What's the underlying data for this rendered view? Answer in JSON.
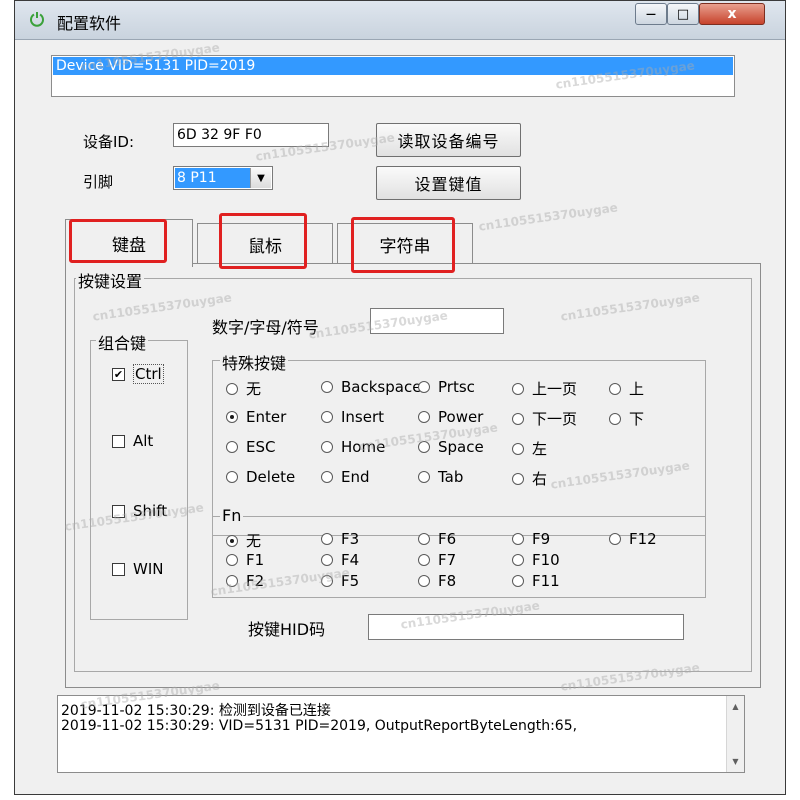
{
  "window": {
    "title": "配置软件",
    "minimize": "—",
    "maximize": "□",
    "close": "x"
  },
  "device_list": {
    "selected": "Device VID=5131 PID=2019"
  },
  "device_id": {
    "label": "设备ID:",
    "value": "6D 32 9F F0"
  },
  "pin": {
    "label": "引脚",
    "value": "8 P11"
  },
  "buttons": {
    "read_device": "读取设备编号",
    "set_key": "设置键值"
  },
  "tabs": [
    {
      "label": "键盘"
    },
    {
      "label": "鼠标"
    },
    {
      "label": "字符串"
    }
  ],
  "key_settings": {
    "group_label": "按键设置",
    "modifiers": {
      "label": "组合键",
      "items": [
        {
          "label": "Ctrl",
          "checked": true
        },
        {
          "label": "Alt",
          "checked": false
        },
        {
          "label": "Shift",
          "checked": false
        },
        {
          "label": "WIN",
          "checked": false
        }
      ]
    },
    "char_field": {
      "label": "数字/字母/符号",
      "value": ""
    },
    "special_keys": {
      "label": "特殊按键",
      "items": [
        {
          "label": "无",
          "selected": false
        },
        {
          "label": "Backspace",
          "selected": false
        },
        {
          "label": "Prtsc",
          "selected": false
        },
        {
          "label": "上一页",
          "selected": false
        },
        {
          "label": "上",
          "selected": false
        },
        {
          "label": "Enter",
          "selected": true
        },
        {
          "label": "Insert",
          "selected": false
        },
        {
          "label": "Power",
          "selected": false
        },
        {
          "label": "下一页",
          "selected": false
        },
        {
          "label": "下",
          "selected": false
        },
        {
          "label": "ESC",
          "selected": false
        },
        {
          "label": "Home",
          "selected": false
        },
        {
          "label": "Space",
          "selected": false
        },
        {
          "label": "左",
          "selected": false
        },
        {
          "label": "Delete",
          "selected": false
        },
        {
          "label": "End",
          "selected": false
        },
        {
          "label": "Tab",
          "selected": false
        },
        {
          "label": "右",
          "selected": false
        }
      ]
    },
    "fn_keys": {
      "label": "Fn",
      "items": [
        {
          "label": "无",
          "selected": true
        },
        {
          "label": "F3",
          "selected": false
        },
        {
          "label": "F6",
          "selected": false
        },
        {
          "label": "F9",
          "selected": false
        },
        {
          "label": "F12",
          "selected": false
        },
        {
          "label": "F1",
          "selected": false
        },
        {
          "label": "F4",
          "selected": false
        },
        {
          "label": "F7",
          "selected": false
        },
        {
          "label": "F10",
          "selected": false
        },
        {
          "label": "F2",
          "selected": false
        },
        {
          "label": "F5",
          "selected": false
        },
        {
          "label": "F8",
          "selected": false
        },
        {
          "label": "F11",
          "selected": false
        }
      ]
    },
    "hid_code": {
      "label": "按键HID码",
      "value": ""
    }
  },
  "log": [
    "2019-11-02 15:30:29: 检测到设备已连接",
    "2019-11-02 15:30:29: VID=5131 PID=2019, OutputReportByteLength:65,"
  ],
  "watermark": "cn1105515370uygae",
  "colors": {
    "selection": "#3399ff",
    "highlight_box": "#e02020"
  }
}
